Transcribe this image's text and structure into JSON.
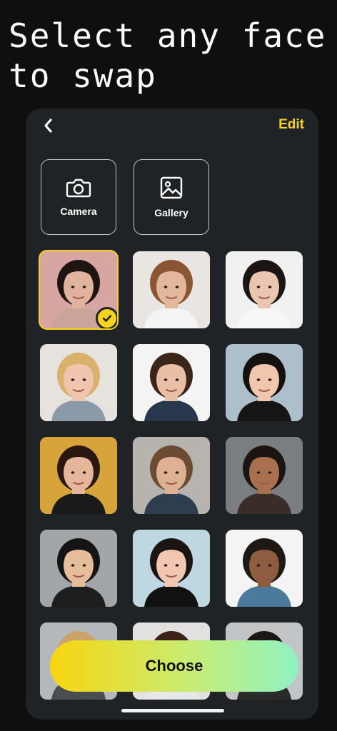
{
  "headline": {
    "line1": "Select any face",
    "line2": "to swap"
  },
  "topbar": {
    "back_icon": "chevron-left-icon",
    "edit_label": "Edit"
  },
  "actions": [
    {
      "label": "Camera",
      "icon": "camera-icon"
    },
    {
      "label": "Gallery",
      "icon": "image-icon"
    }
  ],
  "faces": [
    {
      "bg": "#d7a6a3",
      "hair": "#1e1512",
      "skin": "#e0b39f",
      "shirt": "#caa49a",
      "selected": true
    },
    {
      "bg": "#e8e5e2",
      "hair": "#8a5532",
      "skin": "#e2b89d",
      "shirt": "#f4f4f4",
      "selected": false
    },
    {
      "bg": "#f1f1f1",
      "hair": "#1b1614",
      "skin": "#eac6b2",
      "shirt": "#f7f7f7",
      "selected": false
    },
    {
      "bg": "#e6e2de",
      "hair": "#d9b06c",
      "skin": "#efc6ad",
      "shirt": "#8a9aa8",
      "selected": false
    },
    {
      "bg": "#f4f4f4",
      "hair": "#3a2518",
      "skin": "#e9c0a6",
      "shirt": "#27384c",
      "selected": false
    },
    {
      "bg": "#aebfcc",
      "hair": "#15110f",
      "skin": "#f0c7ad",
      "shirt": "#151515",
      "selected": false
    },
    {
      "bg": "#d7a43c",
      "hair": "#2a1810",
      "skin": "#e6b69a",
      "shirt": "#1a1a1a",
      "selected": false
    },
    {
      "bg": "#b7b4b0",
      "hair": "#6b4b31",
      "skin": "#dfb194",
      "shirt": "#2f3d50",
      "selected": false
    },
    {
      "bg": "#7b7e80",
      "hair": "#1b1411",
      "skin": "#a8704f",
      "shirt": "#3a2c26",
      "selected": false
    },
    {
      "bg": "#a3a6a8",
      "hair": "#141414",
      "skin": "#e6bd9b",
      "shirt": "#1e1e1e",
      "selected": false
    },
    {
      "bg": "#bfd7e0",
      "hair": "#1a1412",
      "skin": "#f1c7b1",
      "shirt": "#111111",
      "selected": false
    },
    {
      "bg": "#f4f4f4",
      "hair": "#1f1915",
      "skin": "#8e5c3e",
      "shirt": "#4b7a9c",
      "selected": false
    },
    {
      "bg": "#b5b8bb",
      "hair": "#c9a36a",
      "skin": "#e4c1aa",
      "shirt": "#4a4d52",
      "selected": false
    },
    {
      "bg": "#e3e1df",
      "hair": "#3b2417",
      "skin": "#ecc5ad",
      "shirt": "#e7e7e7",
      "selected": false
    },
    {
      "bg": "#c2c4c6",
      "hair": "#1c1815",
      "skin": "#d7ab8c",
      "shirt": "#2b2b2b",
      "selected": false
    }
  ],
  "choose_label": "Choose"
}
